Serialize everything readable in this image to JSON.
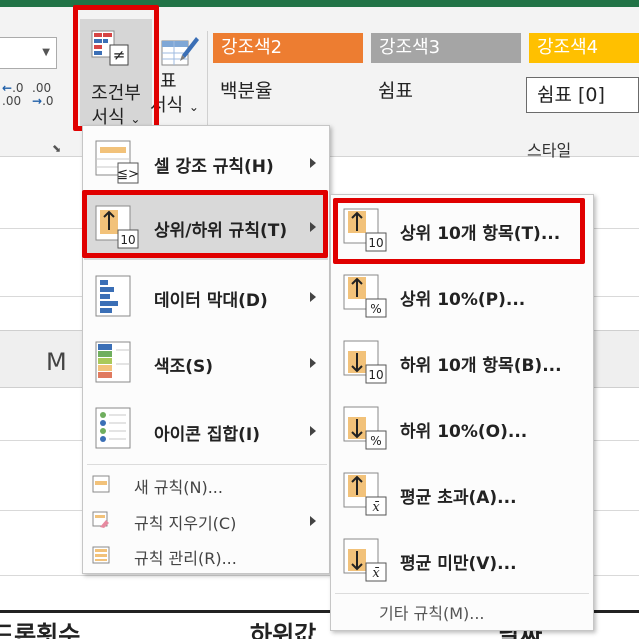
{
  "ribbon": {
    "number_format": {
      "increase_decimal": {
        "top": "←.0",
        "bottom": ".00"
      },
      "decrease_decimal": {
        "top": ".00",
        "bottom": "→.0"
      }
    },
    "conditional_formatting": {
      "line1": "조건부",
      "line2": "서식",
      "caret": "⌄"
    },
    "format_as_table": {
      "line1": "표",
      "line2": "서식",
      "caret": "⌄"
    },
    "styles": {
      "accent2": "강조색2",
      "accent3": "강조색3",
      "accent4": "강조색4",
      "percent": "백분율",
      "comma": "쉼표",
      "comma0": "쉼표 [0]",
      "group_title": "스타일"
    },
    "colors": {
      "accent2": "#ed7d31",
      "accent3": "#a5a5a5",
      "accent4": "#ffc000",
      "excel_green": "#217346",
      "highlight_red": "#e00000"
    }
  },
  "sheet": {
    "column_header": "M",
    "bottom_row": [
      "드론횟수",
      "하위값",
      "날짜"
    ]
  },
  "menu": {
    "items": [
      {
        "label": "셀 강조 규칙(H)",
        "icon": "highlight-cells-rules-icon"
      },
      {
        "label": "상위/하위 규칙(T)",
        "icon": "top-bottom-rules-icon"
      },
      {
        "label": "데이터 막대(D)",
        "icon": "data-bars-icon"
      },
      {
        "label": "색조(S)",
        "icon": "color-scales-icon"
      },
      {
        "label": "아이콘 집합(I)",
        "icon": "icon-sets-icon"
      }
    ],
    "small_items": [
      {
        "label": "새 규칙(N)...",
        "icon": "new-rule-icon"
      },
      {
        "label": "규칙 지우기(C)",
        "icon": "clear-rules-icon"
      },
      {
        "label": "규칙 관리(R)...",
        "icon": "manage-rules-icon"
      }
    ]
  },
  "submenu": {
    "items": [
      {
        "label": "상위 10개 항목(T)...",
        "badge": "10",
        "icon": "top-10-items-icon"
      },
      {
        "label": "상위 10%(P)...",
        "badge": "%",
        "icon": "top-10-percent-icon"
      },
      {
        "label": "하위 10개 항목(B)...",
        "badge": "10",
        "icon": "bottom-10-items-icon"
      },
      {
        "label": "하위 10%(O)...",
        "badge": "%",
        "icon": "bottom-10-percent-icon"
      },
      {
        "label": "평균 초과(A)...",
        "badge": "x̄",
        "icon": "above-average-icon"
      },
      {
        "label": "평균 미만(V)...",
        "badge": "x̄",
        "icon": "below-average-icon"
      }
    ],
    "footer": "기타 규칙(M)..."
  }
}
